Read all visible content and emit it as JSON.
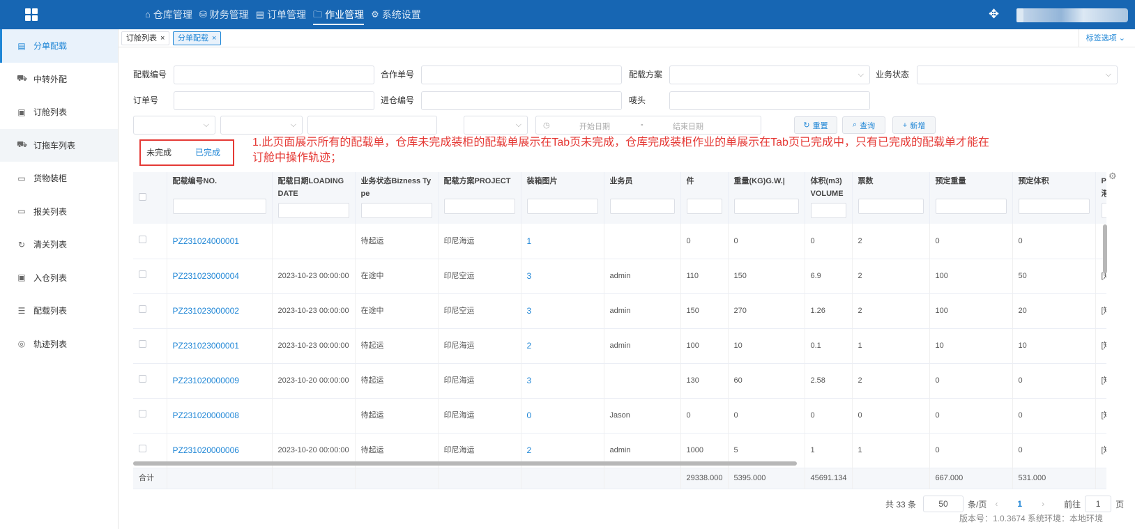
{
  "topnav": {
    "items": [
      {
        "icon": "home-icon",
        "glyph": "⌂",
        "label": "仓库管理"
      },
      {
        "icon": "database-icon",
        "glyph": "⛁",
        "label": "财务管理"
      },
      {
        "icon": "document-icon",
        "glyph": "▤",
        "label": "订单管理"
      },
      {
        "icon": "folder-icon",
        "glyph": "🗀",
        "label": "作业管理",
        "active": true
      },
      {
        "icon": "gear-icon",
        "glyph": "⚙",
        "label": "系统设置"
      }
    ]
  },
  "sidebar": {
    "items": [
      {
        "icon": "document-icon",
        "glyph": "▤",
        "label": "分单配载",
        "active": true
      },
      {
        "icon": "transfer-icon",
        "glyph": "⛟",
        "label": "中转外配"
      },
      {
        "icon": "clipboard-icon",
        "glyph": "▣",
        "label": "订舱列表"
      },
      {
        "icon": "truck-icon",
        "glyph": "⛟",
        "label": "订拖车列表",
        "hover": true
      },
      {
        "icon": "cabinet-icon",
        "glyph": "▭",
        "label": "货物装柜"
      },
      {
        "icon": "briefcase-icon",
        "glyph": "▭",
        "label": "报关列表"
      },
      {
        "icon": "refresh-icon",
        "glyph": "↻",
        "label": "清关列表"
      },
      {
        "icon": "inbound-icon",
        "glyph": "▣",
        "label": "入仓列表"
      },
      {
        "icon": "sliders-icon",
        "glyph": "☰",
        "label": "配载列表"
      },
      {
        "icon": "location-icon",
        "glyph": "◎",
        "label": "轨迹列表"
      }
    ]
  },
  "page_tabs": [
    {
      "label": "订舱列表",
      "close": "×"
    },
    {
      "label": "分单配载",
      "close": "×",
      "active": true
    }
  ],
  "tab_options": "标签选项",
  "filters": {
    "stowage_no": "配载编号",
    "cooperation_no": "合作单号",
    "plan": "配载方案",
    "biz_status": "业务状态",
    "order_no": "订单号",
    "inbound_no": "进仓编号",
    "mark": "唛头",
    "start_date": "开始日期",
    "date_sep": "-",
    "end_date": "结束日期"
  },
  "buttons": {
    "reset": "重置",
    "search": "查询",
    "add": "新增"
  },
  "status_tabs": {
    "incomplete": "未完成",
    "complete": "已完成"
  },
  "annotation": "1.此页面展示所有的配载单，仓库未完成装柜的配载单展示在Tab页未完成，仓库完成装柜作业的单展示在Tab页已完成中，只有已完成的配载单才能在订舱中操作轨迹；",
  "table": {
    "columns": [
      "配载编号NO.",
      "配载日期LOADING DATE",
      "业务状态Bizness Type",
      "配载方案PROJECT",
      "装箱图片",
      "业务员",
      "件",
      "重量(KG)G.W.|",
      "体积(m3)VOLUME",
      "票数",
      "预定重量",
      "预定体积",
      "PO港"
    ],
    "rows": [
      [
        "PZ231024000001",
        "",
        "待起运",
        "印尼海运",
        "1",
        "",
        "0",
        "0",
        "0",
        "2",
        "0",
        "0",
        ""
      ],
      [
        "PZ231023000004",
        "2023-10-23 00:00:00",
        "在途中",
        "印尼空运",
        "3",
        "admin",
        "110",
        "150",
        "6.9",
        "2",
        "100",
        "50",
        "[知 [E"
      ],
      [
        "PZ231023000002",
        "2023-10-23 00:00:00",
        "在途中",
        "印尼空运",
        "3",
        "admin",
        "150",
        "270",
        "1.26",
        "2",
        "100",
        "20",
        "[知 [E"
      ],
      [
        "PZ231023000001",
        "2023-10-23 00:00:00",
        "待起运",
        "印尼海运",
        "2",
        "admin",
        "100",
        "10",
        "0.1",
        "1",
        "10",
        "10",
        "[知 [E"
      ],
      [
        "PZ231020000009",
        "2023-10-20 00:00:00",
        "待起运",
        "印尼海运",
        "3",
        "",
        "130",
        "60",
        "2.58",
        "2",
        "0",
        "0",
        "[知 [E"
      ],
      [
        "PZ231020000008",
        "",
        "待起运",
        "印尼海运",
        "0",
        "Jason",
        "0",
        "0",
        "0",
        "0",
        "0",
        "0",
        "[知 [E"
      ],
      [
        "PZ231020000006",
        "2023-10-20 00:00:00",
        "待起运",
        "印尼海运",
        "2",
        "admin",
        "1000",
        "5",
        "1",
        "1",
        "0",
        "0",
        "[知 [E"
      ]
    ],
    "summary": {
      "label": "合计",
      "pieces": "29338.000",
      "weight": "5395.000",
      "volume": "45691.134",
      "reserved_weight": "667.000",
      "reserved_volume": "531.000"
    }
  },
  "pager": {
    "total": "共 33 条",
    "page_size": "50",
    "per_page": "条/页",
    "prev": "‹",
    "current": "1",
    "next": "›",
    "goto": "前往",
    "goto_value": "1",
    "page_unit": "页"
  },
  "version": "版本号：1.0.3674 系统环境：本地环境"
}
